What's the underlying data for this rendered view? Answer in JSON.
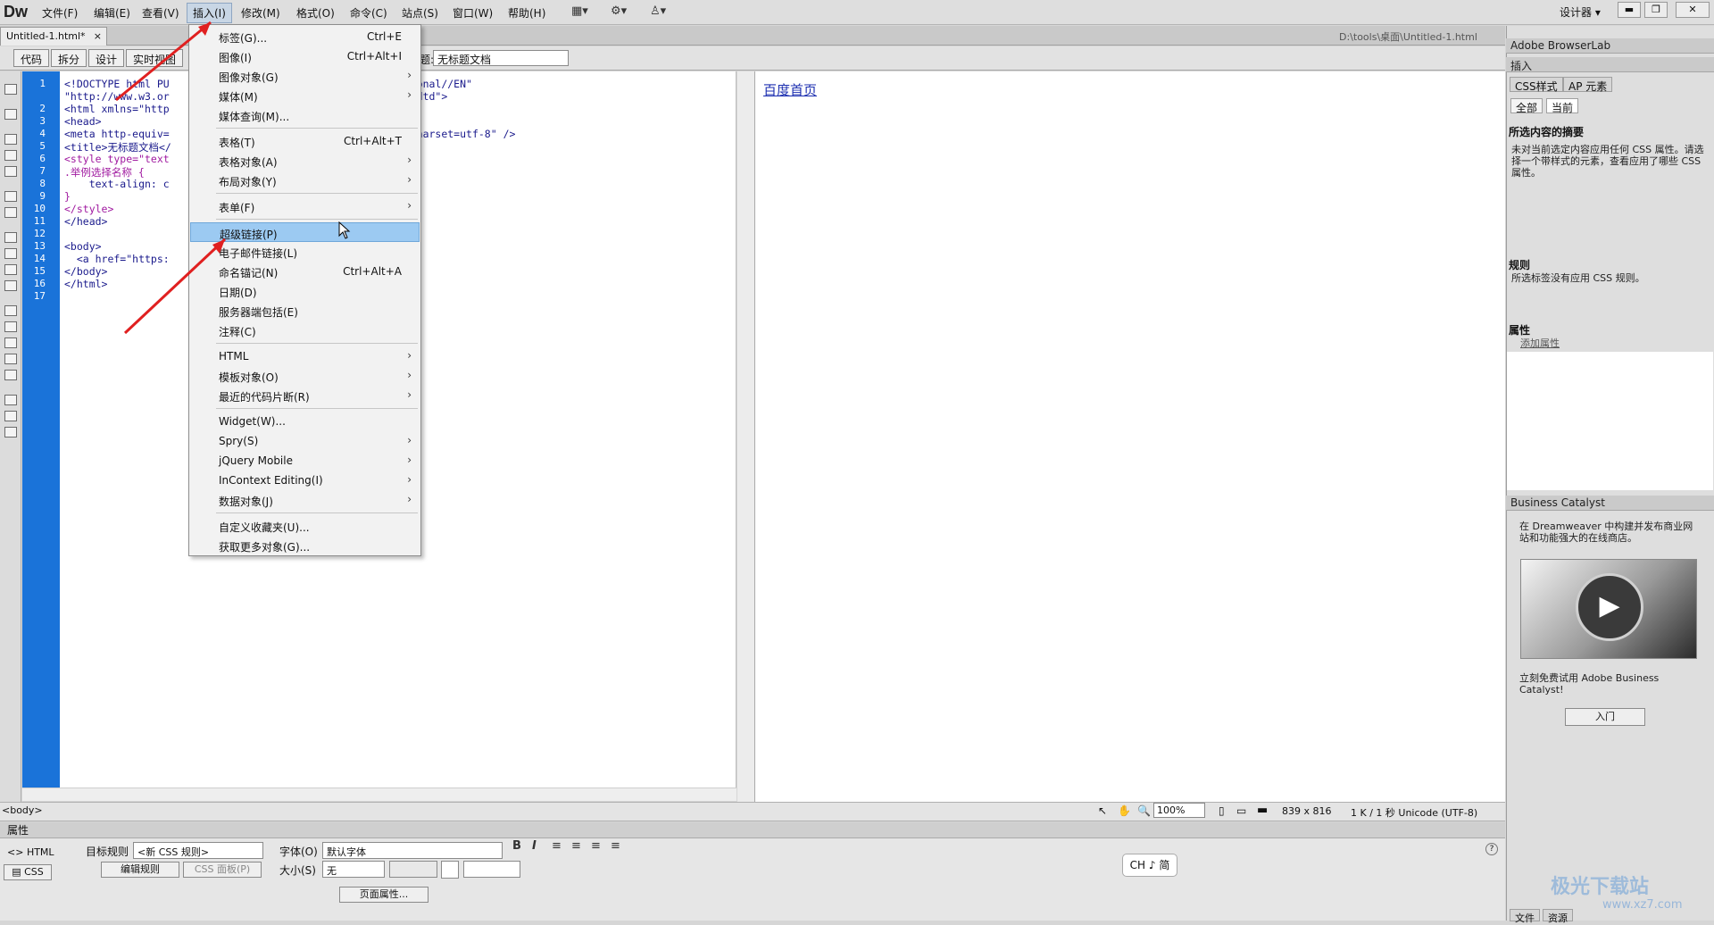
{
  "app": {
    "logo": "Dw",
    "designer_label": "设计器",
    "designer_arrow": "▾",
    "win_min": "▬",
    "win_restore": "❐",
    "win_close": "✕"
  },
  "menubar": [
    "文件(F)",
    "编辑(E)",
    "查看(V)",
    "插入(I)",
    "修改(M)",
    "格式(O)",
    "命令(C)",
    "站点(S)",
    "窗口(W)",
    "帮助(H)"
  ],
  "toolbar_icons": [
    "layout-icon",
    "gear-icon",
    "sitemap-icon"
  ],
  "document": {
    "tab": "Untitled-1.html*",
    "tab_close": "×",
    "path": "D:\\tools\\桌面\\Untitled-1.html",
    "title_label": "标题:",
    "title_value": "无标题文档"
  },
  "view_buttons": [
    "代码",
    "拆分",
    "设计",
    "实时视图"
  ],
  "code": {
    "line_numbers": [
      "1",
      "",
      "2",
      "3",
      "4",
      "5",
      "6",
      "7",
      "8",
      "9",
      "10",
      "11",
      "12",
      "13",
      "14",
      "15",
      "16",
      "17"
    ],
    "lines": [
      "<!DOCTYPE html PU                                     itional//EN\"",
      "\"http://www.w3.or                                     al.dtd\">",
      "<html xmlns=\"http",
      "<head>",
      "<meta http-equiv=                                     ; charset=utf-8\" />",
      "<title>无标题文档</",
      "<style type=\"text",
      ".举例选择名称 {",
      "    text-align: c",
      "}",
      "</style>",
      "</head>",
      "",
      "<body>",
      "  <a href=\"https:",
      "</body>",
      "</html>",
      ""
    ]
  },
  "design": {
    "link_text": "百度首页"
  },
  "insert_menu": {
    "items": [
      {
        "label": "标签(G)...",
        "shortcut": "Ctrl+E"
      },
      {
        "label": "图像(I)",
        "shortcut": "Ctrl+Alt+I"
      },
      {
        "label": "图像对象(G)",
        "submenu": true
      },
      {
        "label": "媒体(M)",
        "submenu": true
      },
      {
        "label": "媒体查询(M)..."
      },
      {
        "label": "表格(T)",
        "shortcut": "Ctrl+Alt+T"
      },
      {
        "label": "表格对象(A)",
        "submenu": true
      },
      {
        "label": "布局对象(Y)",
        "submenu": true
      },
      {
        "label": "表单(F)",
        "submenu": true
      },
      {
        "label": "超级链接(P)",
        "highlighted": true
      },
      {
        "label": "电子邮件链接(L)"
      },
      {
        "label": "命名锚记(N)",
        "shortcut": "Ctrl+Alt+A"
      },
      {
        "label": "日期(D)"
      },
      {
        "label": "服务器端包括(E)"
      },
      {
        "label": "注释(C)"
      },
      {
        "label": "HTML",
        "submenu": true
      },
      {
        "label": "模板对象(O)",
        "submenu": true
      },
      {
        "label": "最近的代码片断(R)",
        "submenu": true
      },
      {
        "label": "Widget(W)..."
      },
      {
        "label": "Spry(S)",
        "submenu": true
      },
      {
        "label": "jQuery Mobile",
        "submenu": true
      },
      {
        "label": "InContext Editing(I)",
        "submenu": true
      },
      {
        "label": "数据对象(J)",
        "submenu": true
      },
      {
        "label": "自定义收藏夹(U)..."
      },
      {
        "label": "获取更多对象(G)..."
      }
    ],
    "arrow": "›"
  },
  "status": {
    "tag": "<body>",
    "zoom": "100%",
    "size": "839 x 816",
    "file": "1 K / 1 秒 Unicode (UTF-8)"
  },
  "properties": {
    "header": "属性",
    "html_btn": "HTML",
    "css_btn": "CSS",
    "target_rule_label": "目标规则",
    "target_rule_value": "<新 CSS 规则>",
    "edit_rule_btn": "编辑规则",
    "css_panel_btn": "CSS 面板(P)",
    "font_label": "字体(O)",
    "font_value": "默认字体",
    "size_label": "大小(S)",
    "size_value": "无",
    "page_props_btn": "页面属性...",
    "format_buttons": [
      "B",
      "I",
      "≡",
      "≡",
      "≡",
      "≡"
    ]
  },
  "ime": {
    "text": "CH ♪ 简"
  },
  "right": {
    "browserlab": "Adobe BrowserLab",
    "insert": "插入",
    "css_tab": "CSS样式",
    "ap_tab": "AP 元素",
    "all_btn": "全部",
    "current_btn": "当前",
    "summary_title": "所选内容的摘要",
    "summary_text": "未对当前选定内容应用任何 CSS 属性。请选择一个带样式的元素，查看应用了哪些 CSS 属性。",
    "rules_title": "规则",
    "rules_text": "所选标签没有应用 CSS 规则。",
    "attrs_title": "属性",
    "add_attr": "添加属性",
    "bc_title": "Business Catalyst",
    "bc_text": "在 Dreamweaver 中构建并发布商业网站和功能强大的在线商店。",
    "bc_try": "立刻免费试用 Adobe Business Catalyst!",
    "bc_enter": "入门",
    "bottom_tabs": [
      "文件",
      "资源"
    ]
  },
  "watermark": {
    "brand": "极光下载站",
    "url": "www.xz7.com"
  }
}
